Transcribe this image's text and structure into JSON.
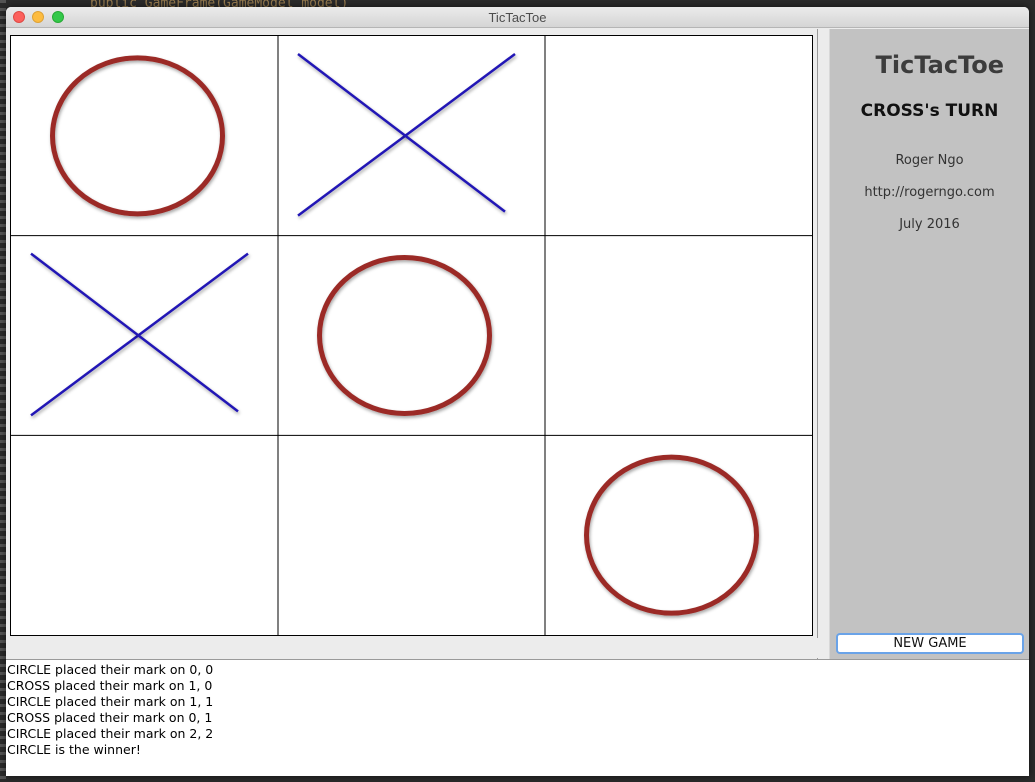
{
  "window": {
    "title": "TicTacToe"
  },
  "background_code": "public GameFrame(GameModel model) {",
  "board": {
    "rows": 3,
    "cols": 3,
    "cells": [
      [
        "circle",
        "cross",
        ""
      ],
      [
        "cross",
        "circle",
        ""
      ],
      [
        "",
        "",
        "circle"
      ]
    ],
    "colors": {
      "circle": "#9b2a26",
      "cross": "#2019b5",
      "grid": "#000000"
    }
  },
  "sidebar": {
    "title": "TicTacToe",
    "turn": "CROSS's TURN",
    "author": "Roger Ngo",
    "url": "http://rogerngo.com",
    "date": "July 2016",
    "new_game_label": "NEW GAME"
  },
  "log": {
    "lines": [
      "CIRCLE placed their mark on 0, 0",
      "CROSS placed their mark on 1, 0",
      "CIRCLE placed their mark on 1, 1",
      "CROSS placed their mark on 0, 1",
      "CIRCLE placed their mark on 2, 2",
      "CIRCLE is the winner!"
    ]
  }
}
